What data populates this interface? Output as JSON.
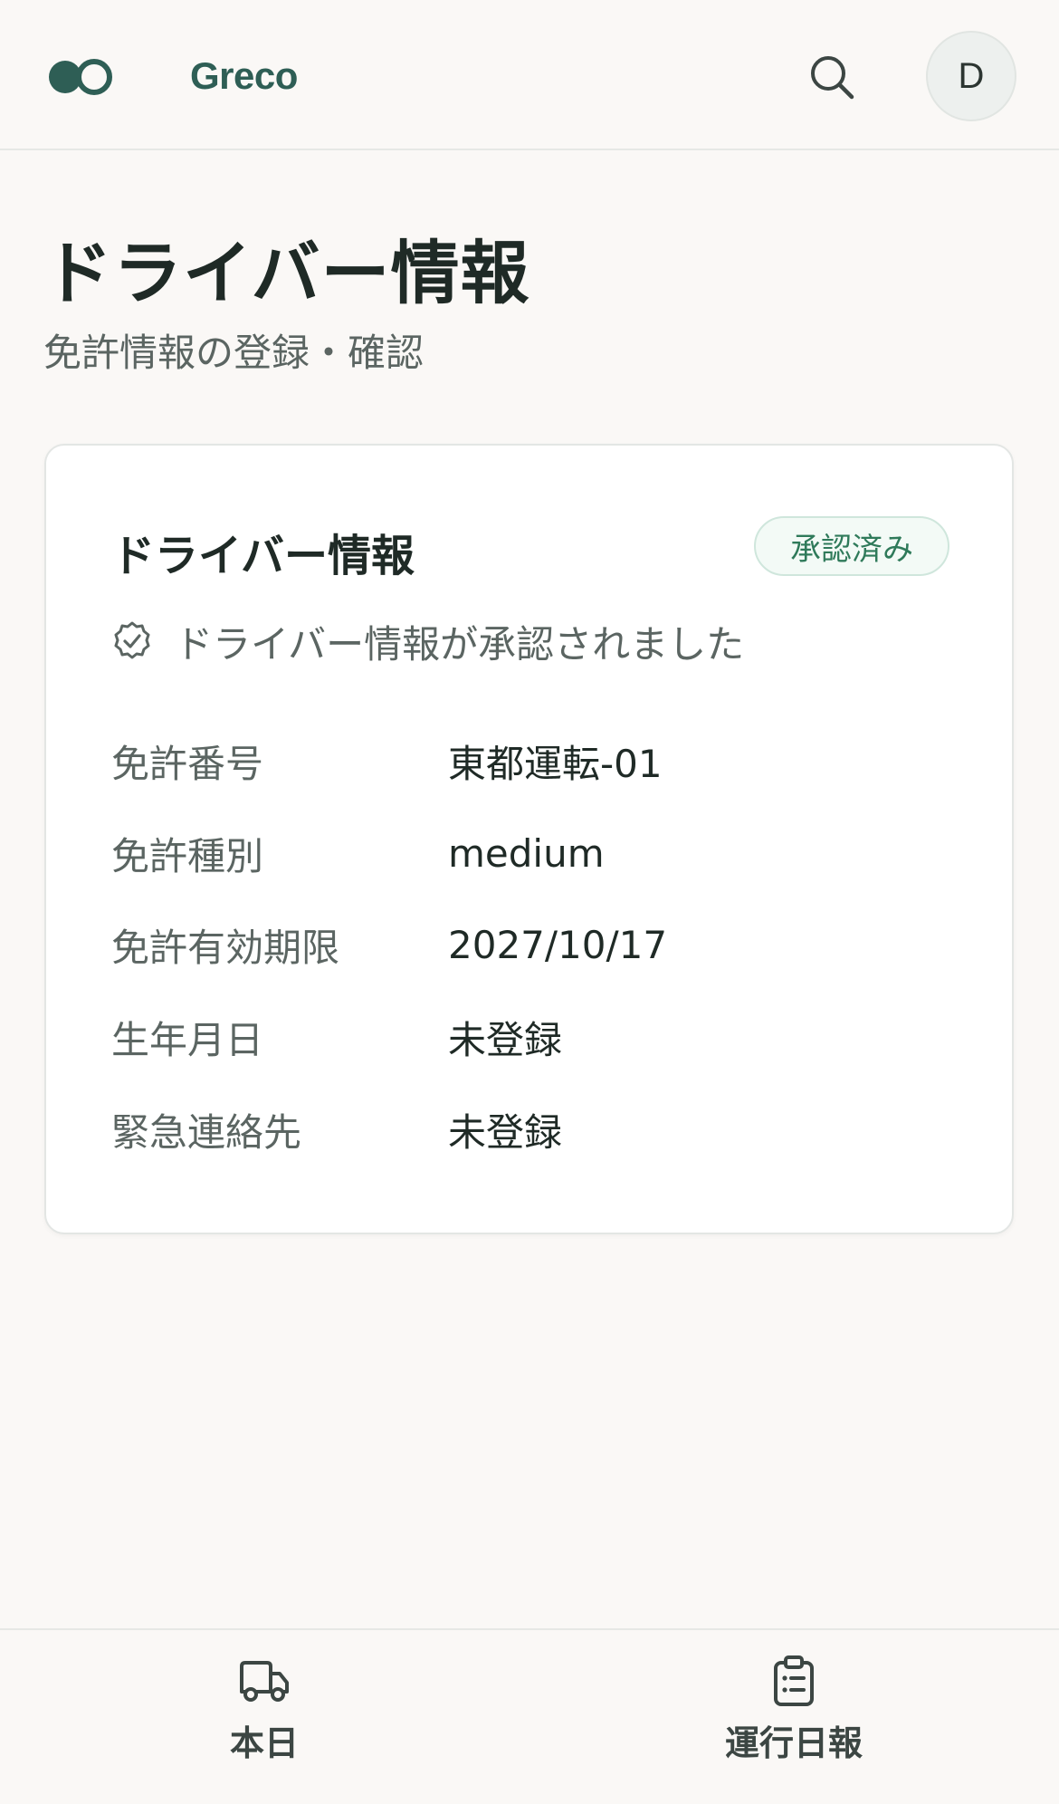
{
  "app": {
    "name": "Greco",
    "brand_color": "#2e5e55",
    "avatar_initial": "D"
  },
  "header": {
    "search_icon": "search-icon"
  },
  "page": {
    "title": "ドライバー情報",
    "subtitle": "免許情報の登録・確認"
  },
  "card": {
    "title": "ドライバー情報",
    "status_badge": "承認済み",
    "status_message": "ドライバー情報が承認されました",
    "status_icon": "verified-badge-icon",
    "fields": [
      {
        "label": "免許番号",
        "value": "東都運転-01"
      },
      {
        "label": "免許種別",
        "value": "medium"
      },
      {
        "label": "免許有効期限",
        "value": "2027/10/17"
      },
      {
        "label": "生年月日",
        "value": "未登録"
      },
      {
        "label": "緊急連絡先",
        "value": "未登録"
      }
    ]
  },
  "bottom_nav": {
    "items": [
      {
        "label": "本日",
        "icon": "truck-icon"
      },
      {
        "label": "運行日報",
        "icon": "clipboard-icon"
      }
    ]
  }
}
